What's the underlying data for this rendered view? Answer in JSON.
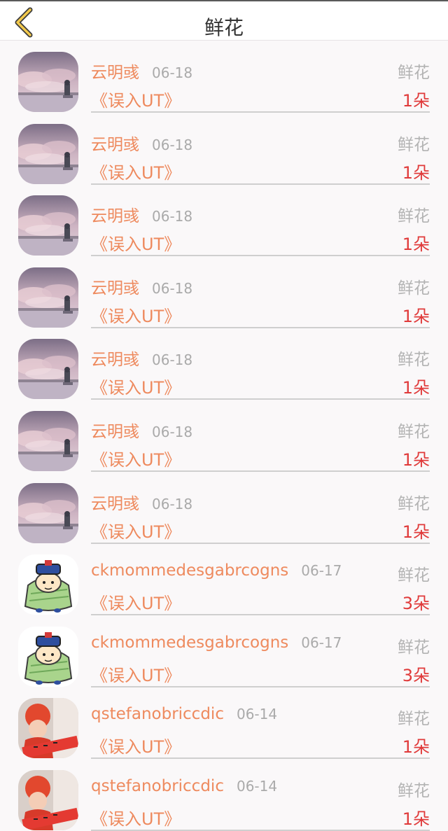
{
  "header": {
    "title": "鲜花"
  },
  "rows": [
    {
      "avatar": "avatar-scenery",
      "user": "云明彧",
      "date": "06-18",
      "book": "《误入UT》",
      "type": "鲜花",
      "amount": "1朵"
    },
    {
      "avatar": "avatar-scenery",
      "user": "云明彧",
      "date": "06-18",
      "book": "《误入UT》",
      "type": "鲜花",
      "amount": "1朵"
    },
    {
      "avatar": "avatar-scenery",
      "user": "云明彧",
      "date": "06-18",
      "book": "《误入UT》",
      "type": "鲜花",
      "amount": "1朵"
    },
    {
      "avatar": "avatar-scenery",
      "user": "云明彧",
      "date": "06-18",
      "book": "《误入UT》",
      "type": "鲜花",
      "amount": "1朵"
    },
    {
      "avatar": "avatar-scenery",
      "user": "云明彧",
      "date": "06-18",
      "book": "《误入UT》",
      "type": "鲜花",
      "amount": "1朵"
    },
    {
      "avatar": "avatar-scenery",
      "user": "云明彧",
      "date": "06-18",
      "book": "《误入UT》",
      "type": "鲜花",
      "amount": "1朵"
    },
    {
      "avatar": "avatar-scenery",
      "user": "云明彧",
      "date": "06-18",
      "book": "《误入UT》",
      "type": "鲜花",
      "amount": "1朵"
    },
    {
      "avatar": "avatar-cartoon",
      "user": "ckmommedesgabrcogns",
      "date": "06-17",
      "book": "《误入UT》",
      "type": "鲜花",
      "amount": "3朵"
    },
    {
      "avatar": "avatar-cartoon",
      "user": "ckmommedesgabrcogns",
      "date": "06-17",
      "book": "《误入UT》",
      "type": "鲜花",
      "amount": "3朵"
    },
    {
      "avatar": "avatar-photo",
      "user": "qstefanobriccdic",
      "date": "06-14",
      "book": "《误入UT》",
      "type": "鲜花",
      "amount": "1朵"
    },
    {
      "avatar": "avatar-photo",
      "user": "qstefanobriccdic",
      "date": "06-14",
      "book": "《误入UT》",
      "type": "鲜花",
      "amount": "1朵"
    }
  ]
}
